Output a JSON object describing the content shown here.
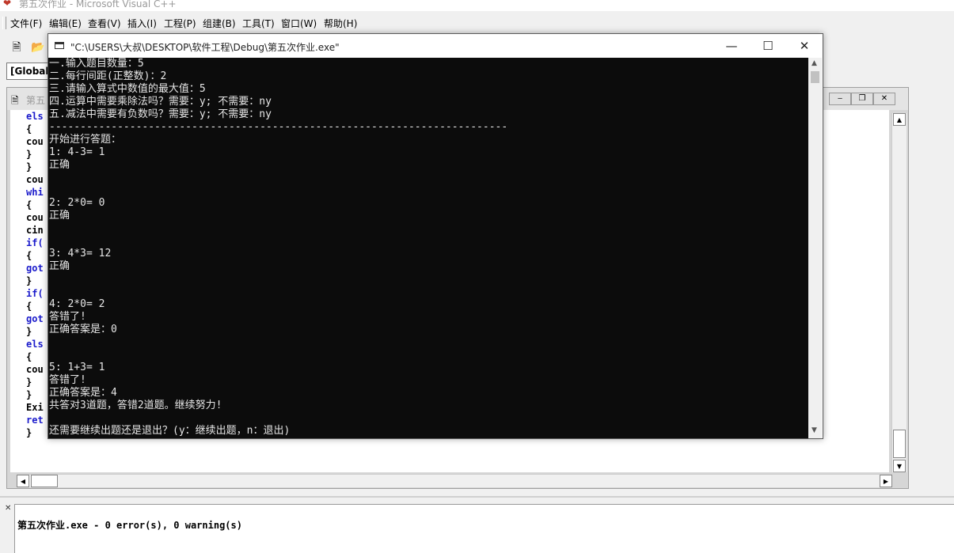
{
  "main_window": {
    "title": "第五次作业 - Microsoft Visual C++",
    "app_icon": "vc-app-icon"
  },
  "menu": [
    {
      "label": "文件(F)"
    },
    {
      "label": "编辑(E)"
    },
    {
      "label": "查看(V)"
    },
    {
      "label": "插入(I)"
    },
    {
      "label": "工程(P)"
    },
    {
      "label": "组建(B)"
    },
    {
      "label": "工具(T)"
    },
    {
      "label": "窗口(W)"
    },
    {
      "label": "帮助(H)"
    }
  ],
  "toolbar": {
    "scope_combo_value": "[Global"
  },
  "editor": {
    "title_fragment": "第五",
    "code_lines": [
      {
        "text": "els",
        "kw": true
      },
      {
        "text": "{",
        "kw": false
      },
      {
        "text": "cou",
        "kw": false
      },
      {
        "text": "}",
        "kw": false
      },
      {
        "text": "}",
        "kw": false
      },
      {
        "text": "cou",
        "kw": false
      },
      {
        "text": "whi",
        "kw": true
      },
      {
        "text": "{",
        "kw": false
      },
      {
        "text": "cou",
        "kw": false
      },
      {
        "text": "cin",
        "kw": false
      },
      {
        "text": "if(",
        "kw": true
      },
      {
        "text": "{",
        "kw": false
      },
      {
        "text": "got",
        "kw": true
      },
      {
        "text": "}",
        "kw": false
      },
      {
        "text": "if(",
        "kw": true
      },
      {
        "text": "{",
        "kw": false
      },
      {
        "text": "got",
        "kw": true
      },
      {
        "text": "}",
        "kw": false
      },
      {
        "text": "els",
        "kw": true
      },
      {
        "text": "{",
        "kw": false
      },
      {
        "text": "cou",
        "kw": false
      },
      {
        "text": "}",
        "kw": false
      },
      {
        "text": "}",
        "kw": false
      },
      {
        "text": "Exi",
        "kw": false
      },
      {
        "text": "ret",
        "kw": true
      },
      {
        "text": "}",
        "kw": false
      }
    ]
  },
  "output": {
    "message": "第五次作业.exe - 0 error(s), 0 warning(s)"
  },
  "console": {
    "title": "\"C:\\USERS\\大叔\\DESKTOP\\软件工程\\Debug\\第五次作业.exe\"",
    "controls": {
      "minimize": "—",
      "maximize": "☐",
      "close": "✕"
    },
    "lines": [
      "一.输入题目数量：5",
      "二.每行间距(正整数)：2",
      "三.请输入算式中数值的最大值：5",
      "四.运算中需要乘除法吗？需要：y; 不需要：ny",
      "五.减法中需要有负数吗？需要：y; 不需要：ny",
      "--------------------------------------------------------------------------",
      "开始进行答题：",
      "1: 4-3= 1",
      "正确",
      "",
      "",
      "2: 2*0= 0",
      "正确",
      "",
      "",
      "3: 4*3= 12",
      "正确",
      "",
      "",
      "4: 2*0= 2",
      "答错了!",
      "正确答案是：0",
      "",
      "",
      "5: 1+3= 1",
      "答错了!",
      "正确答案是：4",
      "共答对3道题，答错2道题。继续努力!",
      "",
      "还需要继续出题还是退出？(y：继续出题，n：退出)"
    ]
  }
}
